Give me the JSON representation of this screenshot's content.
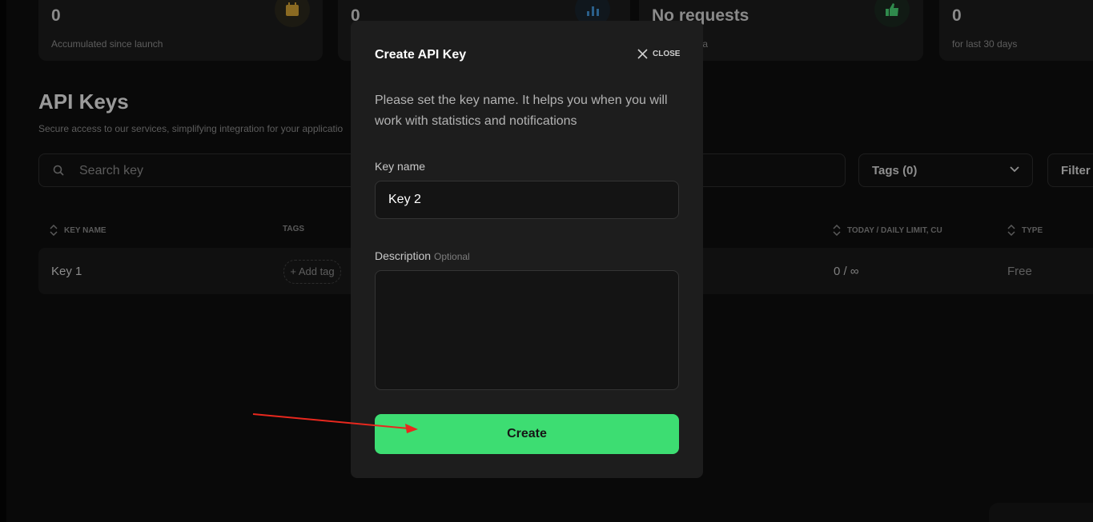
{
  "stats": [
    {
      "value": "0",
      "sub": "Accumulated since launch",
      "icon": "calendar-icon"
    },
    {
      "value": "0",
      "sub": "",
      "icon": "bar-chart-icon"
    },
    {
      "value": "No requests",
      "sub": "ta",
      "icon": "thumbs-up-icon"
    },
    {
      "value": "0",
      "sub": "for last 30 days",
      "icon": ""
    }
  ],
  "section": {
    "title": "API Keys",
    "subtitle": "Secure access to our services, simplifying integration for your applicatio"
  },
  "search": {
    "placeholder": "Search key"
  },
  "tags_filter": {
    "label": "Tags (0)"
  },
  "filter_button": {
    "label": "Filter"
  },
  "table": {
    "headers": {
      "key_name": "KEY NAME",
      "tags": "TAGS",
      "today_limit": "TODAY / DAILY LIMIT, CU",
      "type": "TYPE"
    },
    "rows": [
      {
        "key_name": "Key 1",
        "add_tag": "+ Add tag",
        "today_limit": "0 / ∞",
        "type": "Free"
      }
    ]
  },
  "modal": {
    "title": "Create API Key",
    "close_label": "CLOSE",
    "description": "Please set the key name. It helps you when you will work with statistics and notifications",
    "key_name_label": "Key name",
    "key_name_value": "Key 2",
    "description_label": "Description",
    "description_optional": "Optional",
    "description_value": "",
    "create_label": "Create"
  },
  "colors": {
    "accent": "#3ddd72",
    "annotation_arrow": "#e8281e",
    "calendar_icon": "#b8862a",
    "chart_icon": "#2a6fa8",
    "thumb_icon": "#3aa55c"
  }
}
